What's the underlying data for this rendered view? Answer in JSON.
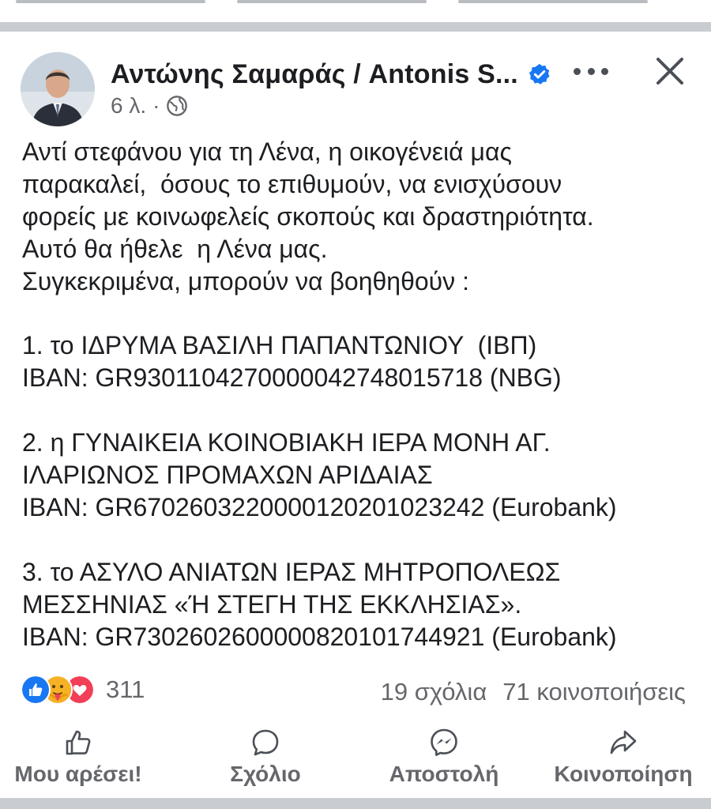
{
  "post": {
    "author": "Αντώνης Σαμαράς /  Antonis S...",
    "time": "6 λ.",
    "body": "Αντί στεφάνου για τη Λένα, η οικογένειά μας\nπαρακαλεί,  όσους το επιθυμούν, να ενισχύσουν\nφορείς με κοινωφελείς σκοπούς και δραστηριότητα.\nΑυτό θα ήθελε  η Λένα μας.\nΣυγκεκριμένα, μπορούν να βοηθηθούν :\n\n1. το ΙΔΡΥΜΑ ΒΑΣΙΛΗ ΠΑΠΑΝΤΩΝΙΟΥ  (ΙΒΠ)\nIBAN: GR9301104270000042748015718 (NBG)\n\n2. η ΓΥΝΑΙΚΕΙΑ ΚΟΙΝΟΒΙΑΚΗ ΙΕΡΑ ΜΟΝΗ ΑΓ.\nΙΛΑΡΙΩΝΟΣ ΠΡΟΜΑΧΩΝ ΑΡΙΔΑΙΑΣ\nIBAN: GR6702603220000120201023242 (Eurobank)\n\n3. το ΑΣΥΛΟ ΑΝΙΑΤΩΝ ΙΕΡΑΣ ΜΗΤΡΟΠΟΛΕΩΣ\nΜΕΣΣΗΝΙΑΣ «Ή ΣΤΕΓΗ ΤΗΣ ΕΚΚΛΗΣΙΑΣ».\nIBAN: GR7302602600000820101744921 (Eurobank)"
  },
  "reactions": {
    "count": "311",
    "icons": [
      "like-icon",
      "care-icon",
      "love-icon"
    ]
  },
  "stats": {
    "comments": "19 σχόλια",
    "shares": "71 κοινοποιήσεις"
  },
  "actions": {
    "like": "Μου αρέσει!",
    "comment": "Σχόλιο",
    "send": "Αποστολή",
    "share": "Κοινοποίηση"
  },
  "colors": {
    "verified_blue": "#1877f2",
    "like_blue": "#1877f2",
    "love_red": "#f33e58",
    "care_yellow": "#f7b125",
    "text_primary": "#1c1e21",
    "text_secondary": "#65676b",
    "divider": "#c9ccd1"
  }
}
